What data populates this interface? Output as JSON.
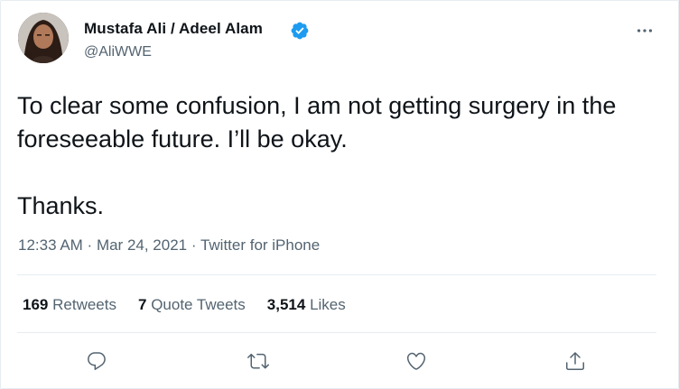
{
  "author": {
    "display_name": "Mustafa Ali / Adeel Alam",
    "handle": "@AliWWE",
    "verified": true
  },
  "tweet": {
    "text": "To clear some confusion, I am not getting surgery in the foreseeable future. I’ll be okay.\n\nThanks."
  },
  "meta": {
    "time": "12:33 AM",
    "separator": " · ",
    "date": "Mar 24, 2021",
    "source": "Twitter for iPhone"
  },
  "stats": {
    "retweets_count": "169",
    "retweets_label": "Retweets",
    "quotes_count": "7",
    "quotes_label": "Quote Tweets",
    "likes_count": "3,514",
    "likes_label": "Likes"
  },
  "icons": {
    "verified": "verified-badge-icon",
    "more": "more-options-icon",
    "reply": "reply-icon",
    "retweet": "retweet-icon",
    "like": "heart-icon",
    "share": "share-icon"
  },
  "colors": {
    "verified_blue": "#1d9bf0",
    "text_primary": "#0f1419",
    "text_secondary": "#536471",
    "divider": "#e6ecf0"
  }
}
